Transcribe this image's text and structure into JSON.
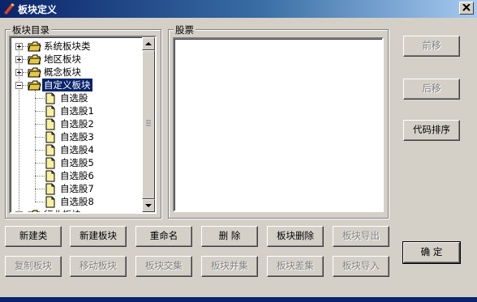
{
  "window": {
    "title": "板块定义"
  },
  "tree": {
    "legend": "板块目录",
    "items": [
      {
        "label": "系统板块类",
        "expander": "plus"
      },
      {
        "label": "地区板块",
        "expander": "plus"
      },
      {
        "label": "概念板块",
        "expander": "plus"
      },
      {
        "label": "自定义板块",
        "expander": "minus",
        "selected": true
      },
      {
        "label": "自选股"
      },
      {
        "label": "自选股1"
      },
      {
        "label": "自选股2"
      },
      {
        "label": "自选股3"
      },
      {
        "label": "自选股4"
      },
      {
        "label": "自选股5"
      },
      {
        "label": "自选股6"
      },
      {
        "label": "自选股7"
      },
      {
        "label": "自选股8"
      },
      {
        "label": "行业板块",
        "expander": "plus"
      }
    ]
  },
  "stocks": {
    "legend": "股票"
  },
  "buttons": {
    "forward": "前移",
    "backward": "后移",
    "sort_by_code": "代码排序",
    "new_category": "新建类",
    "new_block": "新建板块",
    "rename": "重命名",
    "delete": "删  除",
    "delete_block": "板块删除",
    "export_block": "板块导出",
    "copy_block": "复制板块",
    "move_block": "移动板块",
    "intersect": "板块交集",
    "union": "板块并集",
    "difference": "板块差集",
    "import_block": "板块导入",
    "ok": "确  定"
  },
  "colors": {
    "titlebar_start": "#0a246a",
    "titlebar_end": "#a6caf0",
    "selection": "#0a246a",
    "face": "#d4d0c8"
  },
  "icons": {
    "folder": "folder-icon",
    "file": "file-icon",
    "close": "close-icon",
    "app": "app-icon"
  }
}
